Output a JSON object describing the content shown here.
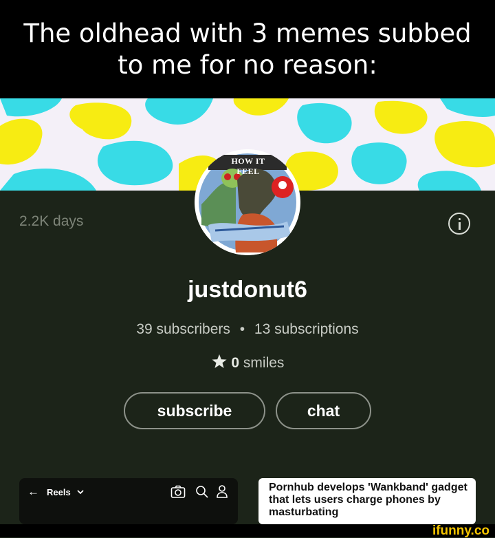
{
  "caption": {
    "line1": "The oldhead with 3 memes subbed",
    "line2": "to me for no reason:"
  },
  "avatar": {
    "badge_text": "HOW IT FEEL"
  },
  "profile": {
    "days": "2.2K days",
    "username": "justdonut6",
    "subscribers": "39 subscribers",
    "separator": "•",
    "subscriptions": "13 subscriptions",
    "smiles_count": "0",
    "smiles_label": "smiles",
    "subscribe_label": "subscribe",
    "chat_label": "chat"
  },
  "reels": {
    "back_arrow": "←",
    "label": "Reels"
  },
  "news": {
    "headline": "Pornhub develops 'Wankband' gadget that lets users charge phones by masturbating"
  },
  "footer": {
    "watermark": "ifunny.co"
  },
  "colors": {
    "background": "#1c2419",
    "banner_yellow": "#f7ec12",
    "banner_cyan": "#38dbe6",
    "watermark": "#f4c400"
  },
  "icons": [
    "info-icon",
    "star-icon",
    "back-arrow-icon",
    "chevron-down-icon",
    "camera-icon",
    "search-icon",
    "user-icon"
  ]
}
